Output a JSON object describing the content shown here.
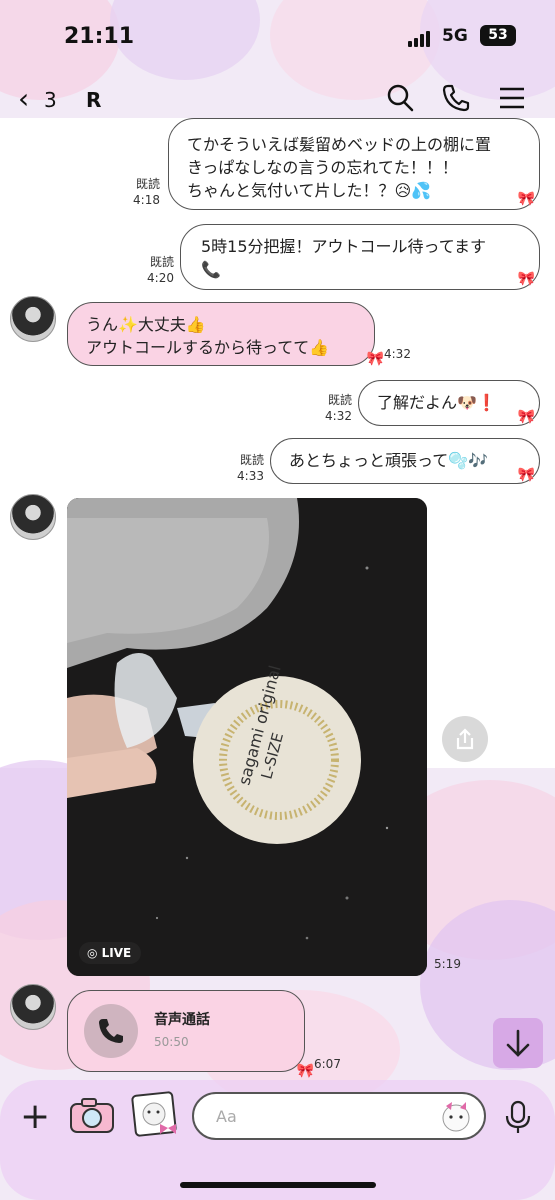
{
  "status_bar": {
    "time": "21:11",
    "network": "5G",
    "battery": "53"
  },
  "header": {
    "back_count": "3",
    "title": "R",
    "icons": [
      "search-icon",
      "phone-icon",
      "menu-icon"
    ]
  },
  "messages": [
    {
      "side": "out",
      "read": "既読",
      "time": "4:18",
      "lines": [
        "てかそういえば髪留めベッドの上の棚に置",
        "きっぱなしなの言うの忘れてた！！！",
        "ちゃんと気付いて片した！？😥💦"
      ]
    },
    {
      "side": "out",
      "read": "既読",
      "time": "4:20",
      "lines": [
        "5時15分把握！アウトコール待ってます",
        "📞"
      ]
    },
    {
      "side": "in",
      "time": "4:32",
      "lines": [
        "うん✨大丈夫👍",
        "アウトコールするから待ってて👍"
      ]
    },
    {
      "side": "out",
      "read": "既読",
      "time": "4:32",
      "lines": [
        "了解だよん🐶❗"
      ]
    },
    {
      "side": "out",
      "read": "既読",
      "time": "4:33",
      "lines": [
        "あとちょっと頑張って🫧🎶"
      ]
    },
    {
      "side": "in",
      "type": "photo",
      "time": "5:19",
      "badge": "LIVE",
      "photo_text": [
        "sagami original",
        "L-SIZE"
      ]
    },
    {
      "side": "in",
      "type": "call",
      "time": "6:07",
      "title": "音声通話",
      "duration": "50:50"
    }
  ],
  "input": {
    "placeholder": "Aa"
  },
  "colors": {
    "bubble_in": "#fad3e4",
    "bubble_out": "#ffffff",
    "accent": "#d7a9e6"
  }
}
